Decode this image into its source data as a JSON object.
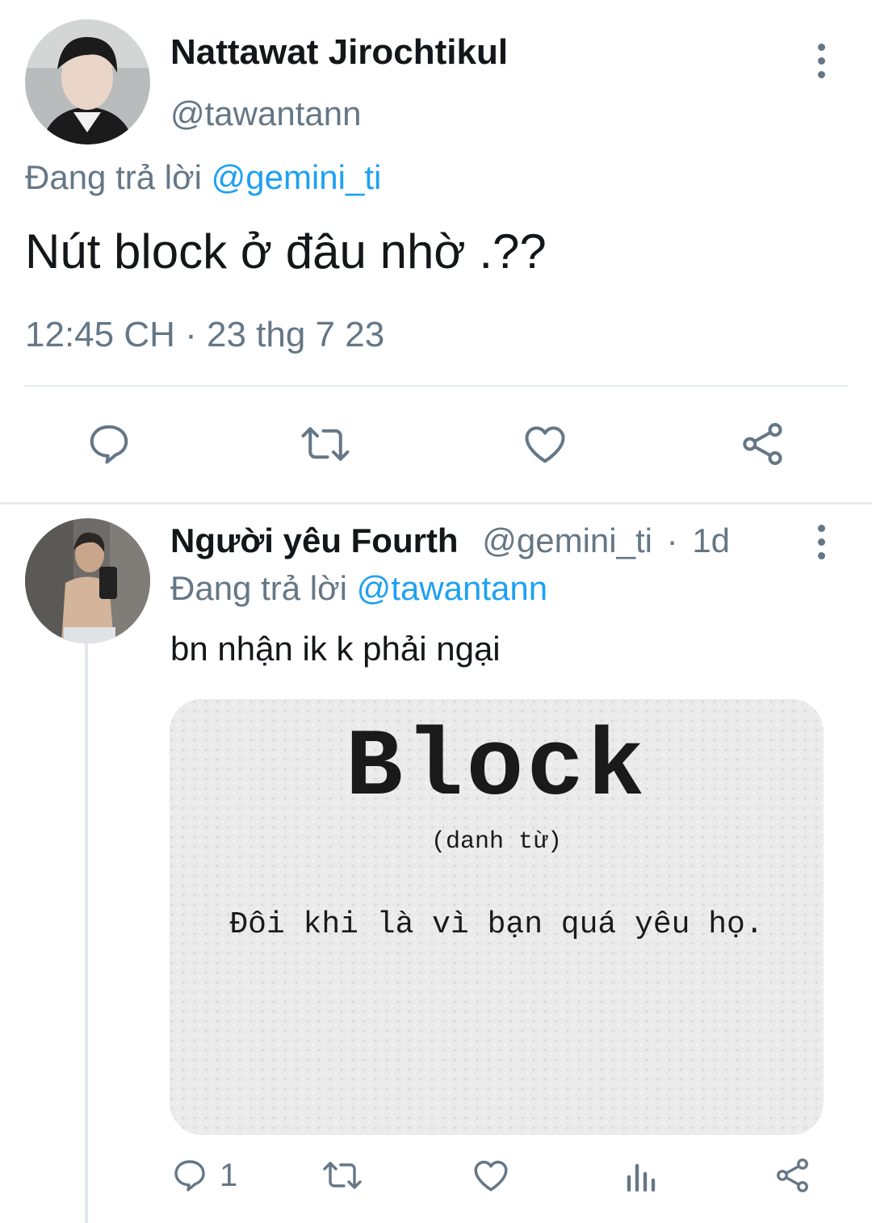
{
  "colors": {
    "accent": "#1da1f2",
    "muted": "#657786",
    "text": "#14171a",
    "divider": "#e6ecf0"
  },
  "main_tweet": {
    "author_name": "Nattawat Jirochtikul",
    "handle": "@tawantann",
    "reply_prefix": "Đang trả lời",
    "reply_to": "@gemini_ti",
    "text": "Nút block ở đâu nhờ .??",
    "timestamp": "12:45 CH · 23 thg 7 23",
    "actions": [
      "reply-icon",
      "retweet-icon",
      "like-icon",
      "share-icon"
    ]
  },
  "reply_tweet": {
    "author_name": "Người yêu Fourth",
    "handle": "@gemini_ti",
    "separator": "·",
    "age": "1d",
    "reply_prefix": "Đang trả lời",
    "reply_to": "@tawantann",
    "text": "bn nhận ik k phải ngại",
    "card": {
      "title": "Block",
      "subtitle": "(danh từ)",
      "definition": "Đôi khi là vì bạn quá yêu họ."
    },
    "reply_count": "1",
    "actions": [
      "reply-icon",
      "retweet-icon",
      "like-icon",
      "analytics-icon",
      "share-icon"
    ]
  }
}
